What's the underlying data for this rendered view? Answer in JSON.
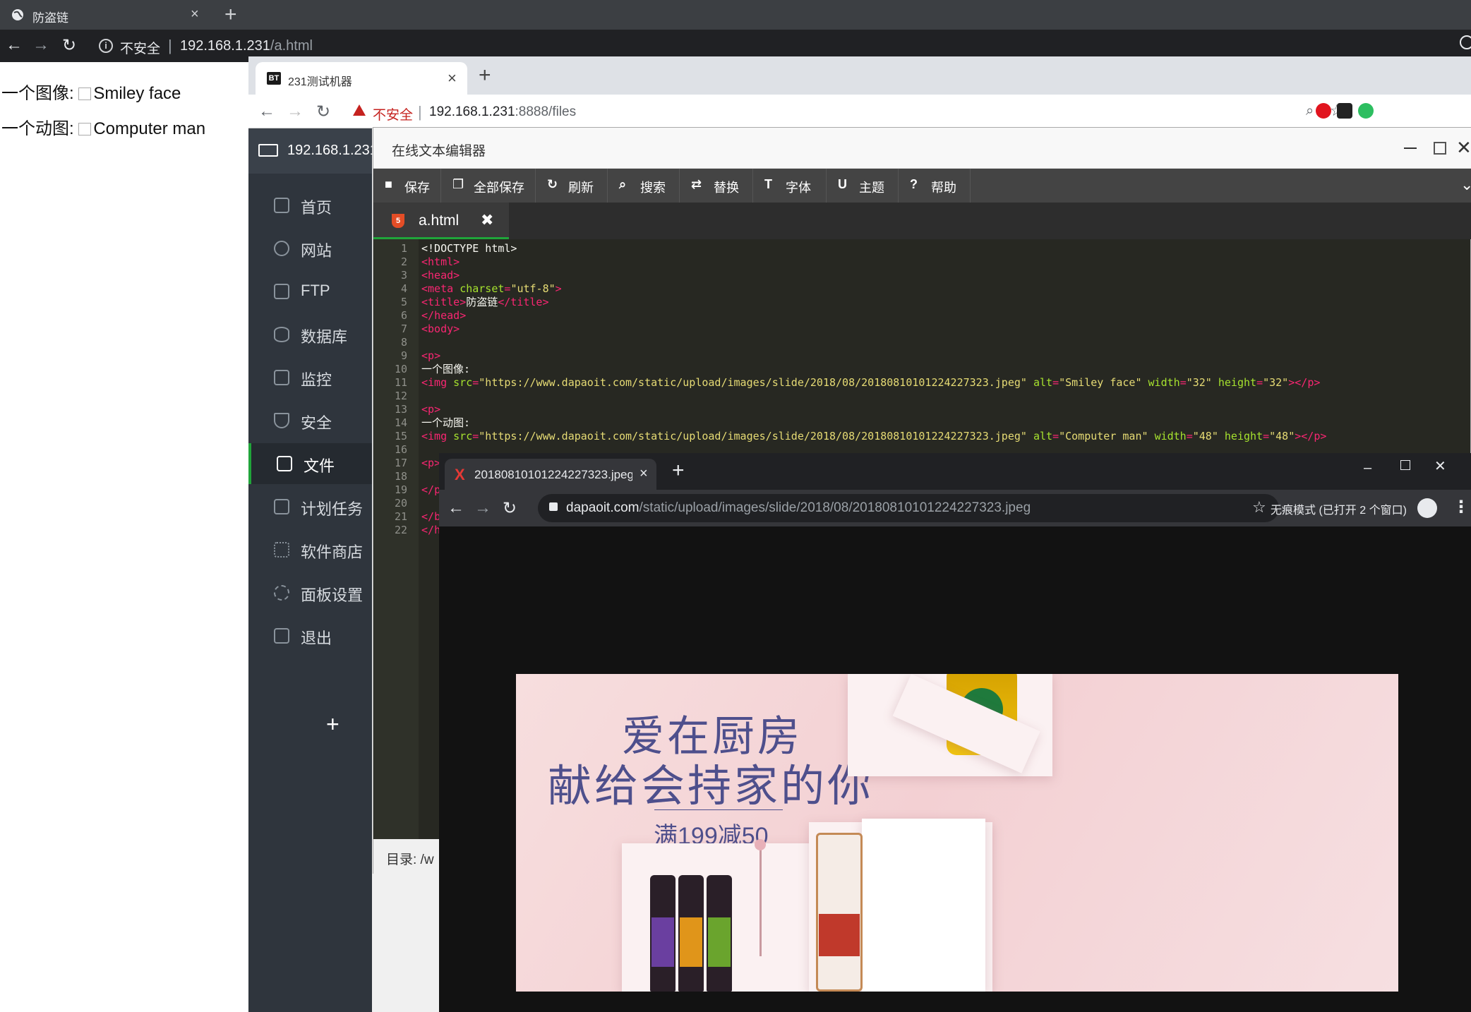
{
  "back_browser": {
    "tab_title": "防盗链",
    "url_security": "不安全",
    "url_host": "192.168.1.231",
    "url_path": "/a.html",
    "page": {
      "line1_label": "一个图像:",
      "line1_alt": "Smiley face",
      "line2_label": "一个动图:",
      "line2_alt": "Computer man"
    }
  },
  "bt_browser": {
    "tab_title": "231测试机器",
    "favicon_text": "BT",
    "url_security": "不安全",
    "url_host": "192.168.1.231",
    "url_path": ":8888/files",
    "sidebar": {
      "server": "192.168.1.231",
      "items": [
        {
          "label": "首页",
          "icon": "home-icon"
        },
        {
          "label": "网站",
          "icon": "globe-icon"
        },
        {
          "label": "FTP",
          "icon": "ftp-icon"
        },
        {
          "label": "数据库",
          "icon": "database-icon"
        },
        {
          "label": "监控",
          "icon": "monitor-icon"
        },
        {
          "label": "安全",
          "icon": "shield-icon"
        },
        {
          "label": "文件",
          "icon": "folder-icon",
          "active": true
        },
        {
          "label": "计划任务",
          "icon": "calendar-icon"
        },
        {
          "label": "软件商店",
          "icon": "grid-icon"
        },
        {
          "label": "面板设置",
          "icon": "gear-icon"
        },
        {
          "label": "退出",
          "icon": "logout-icon"
        }
      ],
      "add": "+"
    }
  },
  "editor": {
    "title": "在线文本编辑器",
    "toolbar": [
      {
        "label": "保存",
        "icon": "save-icon"
      },
      {
        "label": "全部保存",
        "icon": "save-all-icon"
      },
      {
        "label": "刷新",
        "icon": "refresh-icon"
      },
      {
        "label": "搜索",
        "icon": "search-icon"
      },
      {
        "label": "替换",
        "icon": "replace-icon"
      },
      {
        "label": "字体",
        "icon": "font-icon"
      },
      {
        "label": "主题",
        "icon": "theme-icon"
      },
      {
        "label": "帮助",
        "icon": "help-icon"
      }
    ],
    "file_tab": "a.html",
    "status": "目录: /w",
    "line_numbers": [
      "1",
      "2",
      "3",
      "4",
      "5",
      "6",
      "7",
      "8",
      "9",
      "10",
      "11",
      "12",
      "13",
      "14",
      "15",
      "16",
      "17",
      "18",
      "19",
      "20",
      "21",
      "22"
    ],
    "code": [
      [
        [
          "t",
          "<!DOCTYPE html>"
        ]
      ],
      [
        [
          "k",
          "<"
        ],
        [
          "tag",
          "html"
        ],
        [
          "k",
          ">"
        ]
      ],
      [
        [
          "k",
          "<"
        ],
        [
          "tag",
          "head"
        ],
        [
          "k",
          ">"
        ]
      ],
      [
        [
          "k",
          "<"
        ],
        [
          "tag",
          "meta"
        ],
        [
          "t",
          " "
        ],
        [
          "attr",
          "charset"
        ],
        [
          "k",
          "="
        ],
        [
          "str",
          "\"utf-8\""
        ],
        [
          "k",
          ">"
        ]
      ],
      [
        [
          "k",
          "<"
        ],
        [
          "tag",
          "title"
        ],
        [
          "k",
          ">"
        ],
        [
          "t",
          "防盗链"
        ],
        [
          "k",
          "</"
        ],
        [
          "tag",
          "title"
        ],
        [
          "k",
          ">"
        ]
      ],
      [
        [
          "k",
          "</"
        ],
        [
          "tag",
          "head"
        ],
        [
          "k",
          ">"
        ]
      ],
      [
        [
          "k",
          "<"
        ],
        [
          "tag",
          "body"
        ],
        [
          "k",
          ">"
        ]
      ],
      [],
      [
        [
          "k",
          "<"
        ],
        [
          "tag",
          "p"
        ],
        [
          "k",
          ">"
        ]
      ],
      [
        [
          "t",
          "一个图像:"
        ]
      ],
      [
        [
          "k",
          "<"
        ],
        [
          "tag",
          "img"
        ],
        [
          "t",
          " "
        ],
        [
          "attr",
          "src"
        ],
        [
          "k",
          "="
        ],
        [
          "str",
          "\"https://www.dapaoit.com/static/upload/images/slide/2018/08/20180810101224227323.jpeg\""
        ],
        [
          "t",
          " "
        ],
        [
          "attr",
          "alt"
        ],
        [
          "k",
          "="
        ],
        [
          "str",
          "\"Smiley face\""
        ],
        [
          "t",
          " "
        ],
        [
          "attr",
          "width"
        ],
        [
          "k",
          "="
        ],
        [
          "str",
          "\"32\""
        ],
        [
          "t",
          " "
        ],
        [
          "attr",
          "height"
        ],
        [
          "k",
          "="
        ],
        [
          "str",
          "\"32\""
        ],
        [
          "k",
          "></"
        ],
        [
          "tag",
          "p"
        ],
        [
          "k",
          ">"
        ]
      ],
      [],
      [
        [
          "k",
          "<"
        ],
        [
          "tag",
          "p"
        ],
        [
          "k",
          ">"
        ]
      ],
      [
        [
          "t",
          "一个动图:"
        ]
      ],
      [
        [
          "k",
          "<"
        ],
        [
          "tag",
          "img"
        ],
        [
          "t",
          " "
        ],
        [
          "attr",
          "src"
        ],
        [
          "k",
          "="
        ],
        [
          "str",
          "\"https://www.dapaoit.com/static/upload/images/slide/2018/08/20180810101224227323.jpeg\""
        ],
        [
          "t",
          " "
        ],
        [
          "attr",
          "alt"
        ],
        [
          "k",
          "="
        ],
        [
          "str",
          "\"Computer man\""
        ],
        [
          "t",
          " "
        ],
        [
          "attr",
          "width"
        ],
        [
          "k",
          "="
        ],
        [
          "str",
          "\"48\""
        ],
        [
          "t",
          " "
        ],
        [
          "attr",
          "height"
        ],
        [
          "k",
          "="
        ],
        [
          "str",
          "\"48\""
        ],
        [
          "k",
          "></"
        ],
        [
          "tag",
          "p"
        ],
        [
          "k",
          ">"
        ]
      ],
      [],
      [
        [
          "k",
          "<"
        ],
        [
          "tag",
          "p"
        ],
        [
          "k",
          ">"
        ]
      ],
      [],
      [
        [
          "k",
          "</"
        ],
        [
          "tag",
          "p"
        ]
      ],
      [],
      [
        [
          "k",
          "</"
        ],
        [
          "tag",
          "b"
        ]
      ],
      [
        [
          "k",
          "</"
        ],
        [
          "tag",
          "h"
        ]
      ]
    ]
  },
  "incognito_browser": {
    "tab_title": "20180810101224227323.jpeg",
    "url_host": "dapaoit.com",
    "url_path": "/static/upload/images/slide/2018/08/20180810101224227323.jpeg",
    "incognito_label": "无痕模式 (已打开 2 个窗口)",
    "ad": {
      "headline1": "爱在厨房",
      "headline2": "献给会持家的你",
      "promo": "满199减50"
    }
  },
  "colors": {
    "bt_green": "#20a53a",
    "sidebar_bg": "#2f353d",
    "editor_bg": "#272822",
    "ad_text": "#4e4f8c"
  }
}
